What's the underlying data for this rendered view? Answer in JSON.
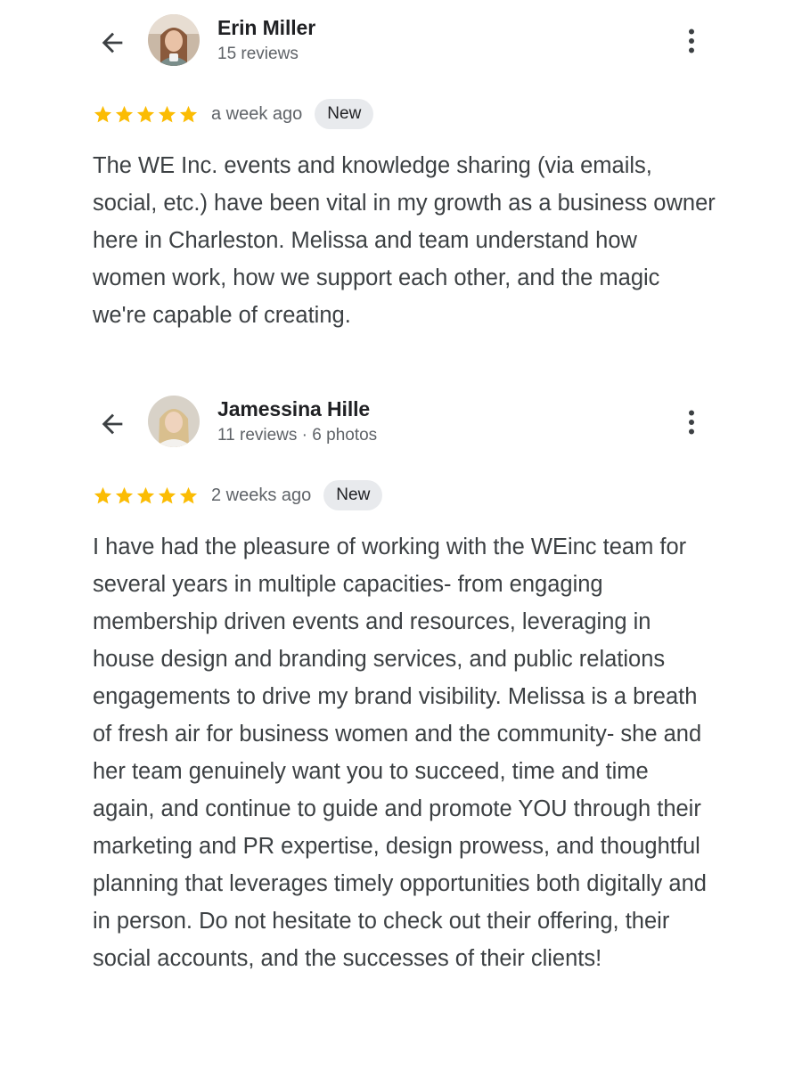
{
  "reviews": [
    {
      "name": "Erin Miller",
      "meta": "15 reviews",
      "rating": 5,
      "time": "a week ago",
      "badge": "New",
      "text": "The WE Inc. events and knowledge sharing (via emails, social, etc.) have been vital in my growth as a business owner here in Charleston. Melissa and team understand how women work, how we support each other, and the magic we're capable of creating."
    },
    {
      "name": "Jamessina Hille",
      "meta": "11 reviews · 6 photos",
      "rating": 5,
      "time": "2 weeks ago",
      "badge": "New",
      "text": "I have had the pleasure of working with the WEinc team for several years in multiple capacities- from engaging membership driven events and resources, leveraging in house design and branding services, and public relations engagements to drive my brand visibility. Melissa is a breath of fresh air for business women and the community- she and her team genuinely want you to succeed, time and time again, and continue to guide and promote YOU through their marketing and PR expertise, design prowess, and thoughtful planning that leverages timely opportunities both digitally and in person. Do not hesitate to check out their offering, their social accounts, and the successes of their clients!"
    }
  ],
  "icons": {
    "back": "arrow-back-icon",
    "more": "more-vert-icon",
    "star": "star-icon"
  },
  "colors": {
    "star": "#fbbc04",
    "badge_bg": "#e8eaed",
    "name": "#202124",
    "secondary": "#5f6368",
    "body": "#3c4043"
  }
}
